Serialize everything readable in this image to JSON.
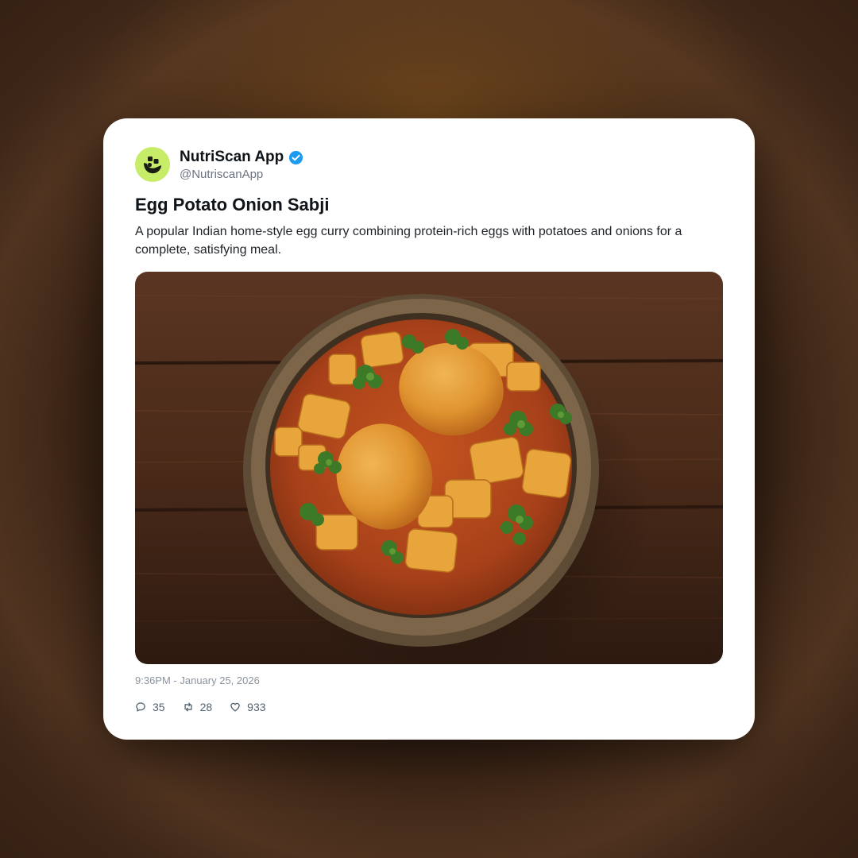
{
  "post": {
    "author": {
      "name": "NutriScan App",
      "handle": "@NutriscanApp",
      "verified": true,
      "avatar_color": "#c6ec68"
    },
    "title": "Egg Potato Onion Sabji",
    "description": "A popular Indian home-style egg curry combining protein-rich eggs with potatoes and onions for a complete, satisfying meal.",
    "image_icon": "egg-potato-curry-bowl-photo",
    "timestamp": "9:36PM - January 25, 2026",
    "stats": {
      "replies": "35",
      "reposts": "28",
      "likes": "933"
    },
    "icons": {
      "replies": "comment-icon",
      "reposts": "repost-icon",
      "likes": "heart-icon",
      "verified": "verified-badge-icon"
    },
    "colors": {
      "verified": "#1d9bf0",
      "card": "#ffffff",
      "text": "#0f1419",
      "muted": "#6b7280"
    }
  }
}
